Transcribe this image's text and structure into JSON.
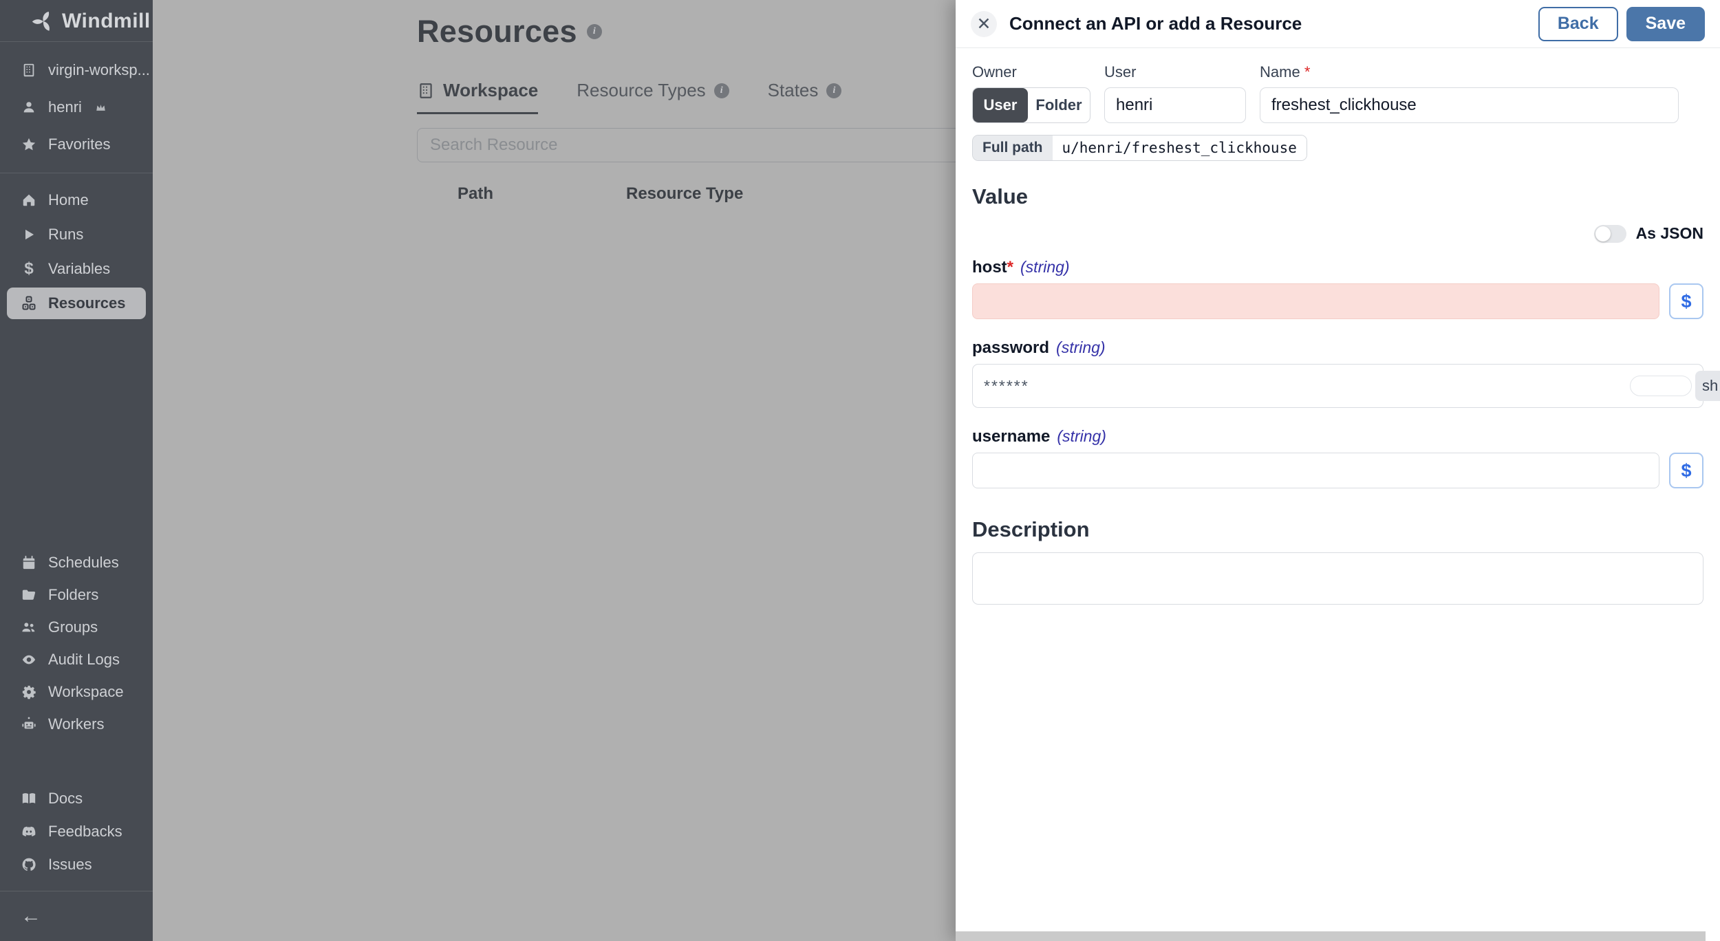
{
  "app": {
    "brand": "Windmill"
  },
  "sidebar": {
    "workspace": "virgin-worksp...",
    "user": "henri",
    "favorites": "Favorites",
    "nav_top": [
      {
        "label": "Home",
        "icon": "home-icon",
        "active": false
      },
      {
        "label": "Runs",
        "icon": "play-icon",
        "active": false
      },
      {
        "label": "Variables",
        "icon": "dollar-icon",
        "active": false
      },
      {
        "label": "Resources",
        "icon": "cubes-icon",
        "active": true
      }
    ],
    "nav_admin": [
      {
        "label": "Schedules",
        "icon": "calendar-icon"
      },
      {
        "label": "Folders",
        "icon": "folder-icon"
      },
      {
        "label": "Groups",
        "icon": "users-icon"
      },
      {
        "label": "Audit Logs",
        "icon": "eye-icon"
      },
      {
        "label": "Workspace",
        "icon": "gear-icon"
      },
      {
        "label": "Workers",
        "icon": "robot-icon"
      }
    ],
    "nav_bottom": [
      {
        "label": "Docs",
        "icon": "book-icon"
      },
      {
        "label": "Feedbacks",
        "icon": "discord-icon"
      },
      {
        "label": "Issues",
        "icon": "github-icon"
      }
    ]
  },
  "main": {
    "title": "Resources",
    "tabs": [
      {
        "label": "Workspace",
        "active": true
      },
      {
        "label": "Resource Types",
        "active": false
      },
      {
        "label": "States",
        "active": false
      }
    ],
    "search_placeholder": "Search Resource",
    "table_headers": {
      "path": "Path",
      "resource_type": "Resource Type"
    }
  },
  "drawer": {
    "title": "Connect an API or add a Resource",
    "back_label": "Back",
    "save_label": "Save",
    "owner": {
      "label": "Owner",
      "option_user": "User",
      "option_folder": "Folder",
      "selected": "User"
    },
    "user_field": {
      "label": "User",
      "value": "henri"
    },
    "name_field": {
      "label": "Name",
      "required_mark": "*",
      "value": "freshest_clickhouse"
    },
    "full_path": {
      "label": "Full path",
      "value": "u/henri/freshest_clickhouse"
    },
    "value_section": {
      "heading": "Value",
      "as_json_label": "As JSON",
      "as_json_on": false
    },
    "host_field": {
      "name": "host",
      "required_mark": "*",
      "type": "(string)",
      "value": "",
      "dollar": "$"
    },
    "password_field": {
      "name": "password",
      "type": "(string)",
      "value": "******",
      "show_chip": "sh"
    },
    "username_field": {
      "name": "username",
      "type": "(string)",
      "value": "",
      "dollar": "$"
    },
    "description_section": {
      "heading": "Description",
      "value": ""
    }
  },
  "colors": {
    "accent_blue": "#4b76a9",
    "link_blue": "#3f6da6",
    "dollar_blue": "#2f6be4",
    "type_indigo": "#3532a8",
    "danger_red": "#dc2626",
    "invalid_bg": "#fbdfdb",
    "sidebar_bg": "#474b52",
    "backdrop": "#b0b0b0"
  }
}
